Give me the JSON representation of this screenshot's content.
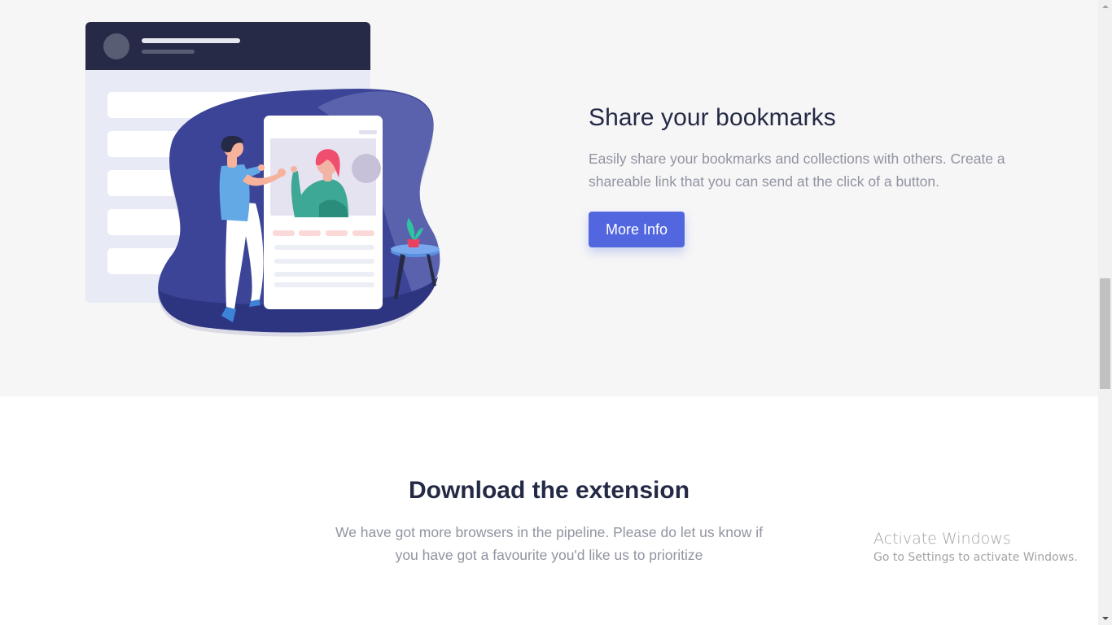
{
  "feature": {
    "title": "Share your bookmarks",
    "description": "Easily share your bookmarks and collections with others. Create a shareable link that you can send at the click of a button.",
    "button_label": "More Info"
  },
  "download": {
    "title": "Download the extension",
    "description": "We have got more browsers in the pipeline. Please do let us know if you have got a favourite you'd like us to prioritize"
  },
  "watermark": {
    "title": "Activate Windows",
    "subtitle": "Go to Settings to activate Windows."
  },
  "colors": {
    "primary": "#5267df",
    "dark_blue": "#242a45",
    "grey_text": "#9194a1",
    "feature_bg": "#f6f6f7"
  },
  "icons": [
    "share-illustration",
    "scroll-up-arrow-icon",
    "scroll-down-arrow-icon"
  ]
}
